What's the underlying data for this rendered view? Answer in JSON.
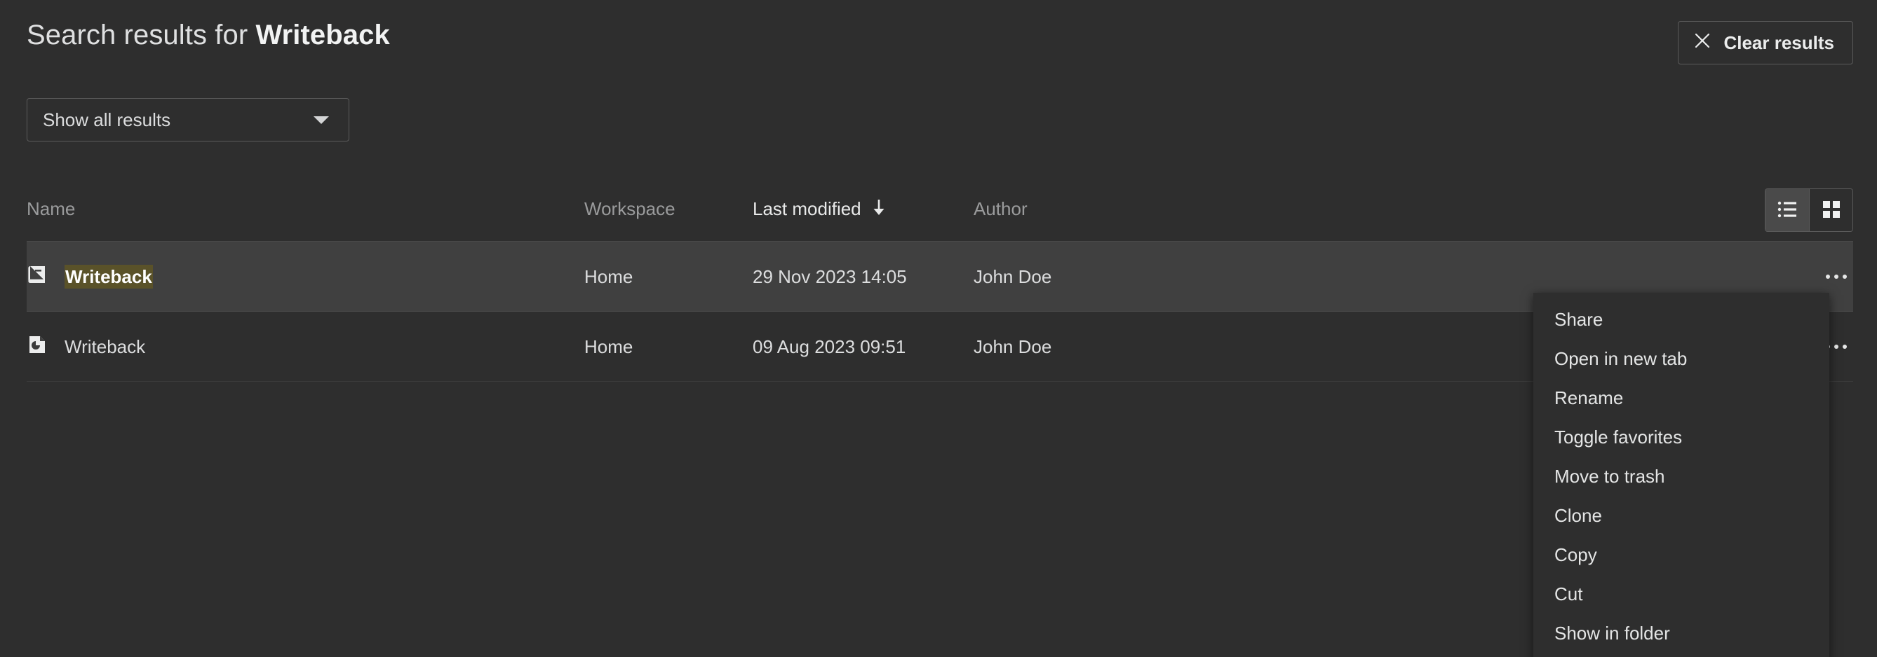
{
  "header": {
    "title_prefix": "Search results for ",
    "query": "Writeback",
    "clear_button_label": "Clear results",
    "clear_button_icon": "close-icon"
  },
  "filter": {
    "selected_label": "Show all results",
    "caret_icon": "chevron-down-icon"
  },
  "table": {
    "columns": [
      {
        "key": "name",
        "label": "Name",
        "sorted": false
      },
      {
        "key": "workspace",
        "label": "Workspace",
        "sorted": false
      },
      {
        "key": "modified",
        "label": "Last modified",
        "sorted": true,
        "sort_direction": "descending",
        "sort_icon": "arrow-down-icon"
      },
      {
        "key": "author",
        "label": "Author",
        "sorted": false
      }
    ],
    "view_modes": [
      {
        "name": "list-view",
        "icon": "list-view-icon",
        "selected": true
      },
      {
        "name": "grid-view",
        "icon": "grid-view-icon",
        "selected": false
      }
    ],
    "rows": [
      {
        "icon": "book-icon",
        "name": "Writeback",
        "name_highlighted": "Writeback",
        "bold": true,
        "workspace": "Home",
        "modified": "29 Nov 2023 14:05",
        "author": "John Doe",
        "selected": true,
        "menu_icon": "ellipsis-icon"
      },
      {
        "icon": "sheet-pie-icon",
        "name": "Writeback",
        "name_highlighted": "",
        "bold": false,
        "workspace": "Home",
        "modified": "09 Aug 2023 09:51",
        "author": "John Doe",
        "selected": false,
        "menu_icon": "ellipsis-icon"
      }
    ]
  },
  "context_menu": {
    "visible": true,
    "items": [
      {
        "label": "Share"
      },
      {
        "label": "Open in new tab"
      },
      {
        "label": "Rename"
      },
      {
        "label": "Toggle favorites"
      },
      {
        "label": "Move to trash"
      },
      {
        "label": "Clone"
      },
      {
        "label": "Copy"
      },
      {
        "label": "Cut"
      },
      {
        "label": "Show in folder"
      }
    ]
  },
  "colors": {
    "background": "#2e2e2e",
    "row_selected": "#404040",
    "text_primary": "#dcddde",
    "text_muted": "#9a9b9c",
    "border": "#5b5b5b",
    "search_highlight": "#5a5229"
  }
}
